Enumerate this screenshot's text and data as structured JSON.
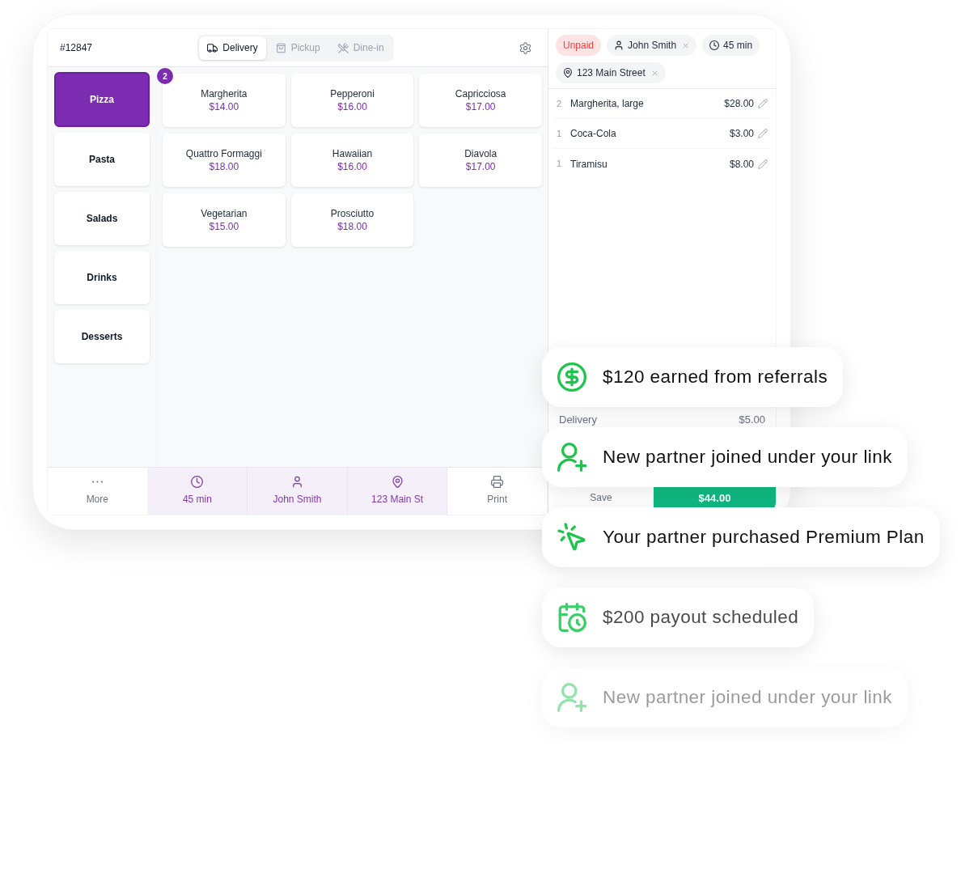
{
  "order": {
    "number": "#12847"
  },
  "order_types": [
    {
      "kind": "delivery",
      "label": "Delivery",
      "selected": true
    },
    {
      "kind": "pickup",
      "label": "Pickup",
      "selected": false
    },
    {
      "kind": "dine_in",
      "label": "Dine-in",
      "selected": false
    }
  ],
  "categories": [
    {
      "label": "Pizza",
      "selected": true
    },
    {
      "label": "Pasta",
      "selected": false
    },
    {
      "label": "Salads",
      "selected": false
    },
    {
      "label": "Drinks",
      "selected": false
    },
    {
      "label": "Desserts",
      "selected": false
    }
  ],
  "products": [
    {
      "name": "Margherita",
      "price": "$14.00",
      "badge": "2"
    },
    {
      "name": "Pepperoni",
      "price": "$16.00"
    },
    {
      "name": "Capricciosa",
      "price": "$17.00"
    },
    {
      "name": "Quattro Formaggi",
      "price": "$18.00"
    },
    {
      "name": "Hawaiian",
      "price": "$16.00"
    },
    {
      "name": "Diavola",
      "price": "$17.00"
    },
    {
      "name": "Vegetarian",
      "price": "$15.00"
    },
    {
      "name": "Prosciutto",
      "price": "$18.00"
    }
  ],
  "toolbar": [
    {
      "kind": "more",
      "label": "More",
      "active": false
    },
    {
      "kind": "time",
      "label": "45 min",
      "active": true
    },
    {
      "kind": "customer",
      "label": "John Smith",
      "active": true
    },
    {
      "kind": "address",
      "label": "123 Main St",
      "active": true
    },
    {
      "kind": "print",
      "label": "Print",
      "active": false
    }
  ],
  "order_panel": {
    "chips": [
      {
        "kind": "status",
        "label": "Unpaid",
        "removable": false
      },
      {
        "kind": "customer",
        "label": "John Smith",
        "removable": true
      },
      {
        "kind": "time",
        "label": "45 min",
        "removable": false
      },
      {
        "kind": "address",
        "label": "123 Main Street",
        "removable": true
      }
    ],
    "lines": [
      {
        "qty": "2",
        "name": "Margherita, large",
        "price": "$28.00"
      },
      {
        "qty": "1",
        "name": "Coca-Cola",
        "price": "$3.00"
      },
      {
        "qty": "1",
        "name": "Tiramisu",
        "price": "$8.00"
      }
    ],
    "summary": [
      {
        "label": "Delivery",
        "value": "$5.00"
      }
    ],
    "save_label": "Save",
    "pay_amount": "$44.00"
  },
  "notifications": [
    {
      "kind": "earning",
      "text": "$120 earned from referrals",
      "dimmed": false,
      "faded": false
    },
    {
      "kind": "signup",
      "text": "New partner joined under your link",
      "dimmed": false,
      "faded": false
    },
    {
      "kind": "purchase",
      "text": "Your partner purchased Premium Plan",
      "dimmed": false,
      "faded": false
    },
    {
      "kind": "payout",
      "text": "$200 payout scheduled",
      "dimmed": true,
      "faded": false
    },
    {
      "kind": "signup",
      "text": "New partner joined under your link",
      "dimmed": true,
      "faded": true
    }
  ]
}
